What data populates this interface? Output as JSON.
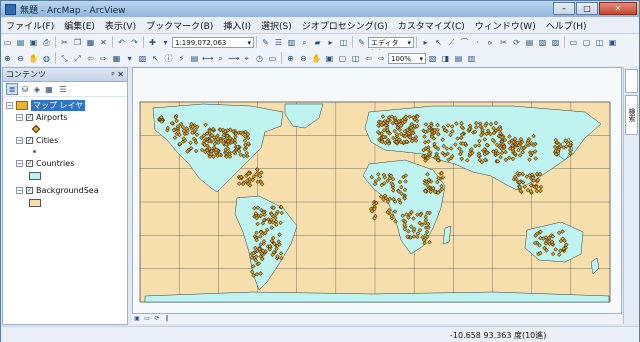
{
  "window": {
    "title": "無題 - ArcMap - ArcView"
  },
  "menu": [
    "ファイル(F)",
    "編集(E)",
    "表示(V)",
    "ブックマーク(B)",
    "挿入(I)",
    "選択(S)",
    "ジオプロセシング(G)",
    "カスタマイズ(C)",
    "ウィンドウ(W)",
    "ヘルプ(H)"
  ],
  "toolbar": {
    "scale": "1:199,072,063",
    "editor_label": "エディタ(R)",
    "zoom_percent": "100%"
  },
  "toc": {
    "title": "コンテンツ",
    "pin": "ᵖ ✕",
    "dataframe": "マップ レイヤ",
    "layers": [
      {
        "name": "Airports",
        "checked": "✓"
      },
      {
        "name": "Cities",
        "checked": "✓"
      },
      {
        "name": "Countries",
        "checked": "✓"
      },
      {
        "name": "BackgroundSea",
        "checked": "✓"
      }
    ]
  },
  "right_panels": [
    "",
    "検索"
  ],
  "status": {
    "coords": "-10.658  93.363 度(10進)"
  },
  "colors": {
    "land": "#bef3ef",
    "sea": "#f6dfac",
    "points": "#e7a52a",
    "point_outline": "#3a2800"
  },
  "icons": {
    "add_data": "plus-icon",
    "zoom": "magnifier-icon",
    "pan": "hand-icon",
    "identify": "info-icon",
    "close": "close-icon"
  }
}
